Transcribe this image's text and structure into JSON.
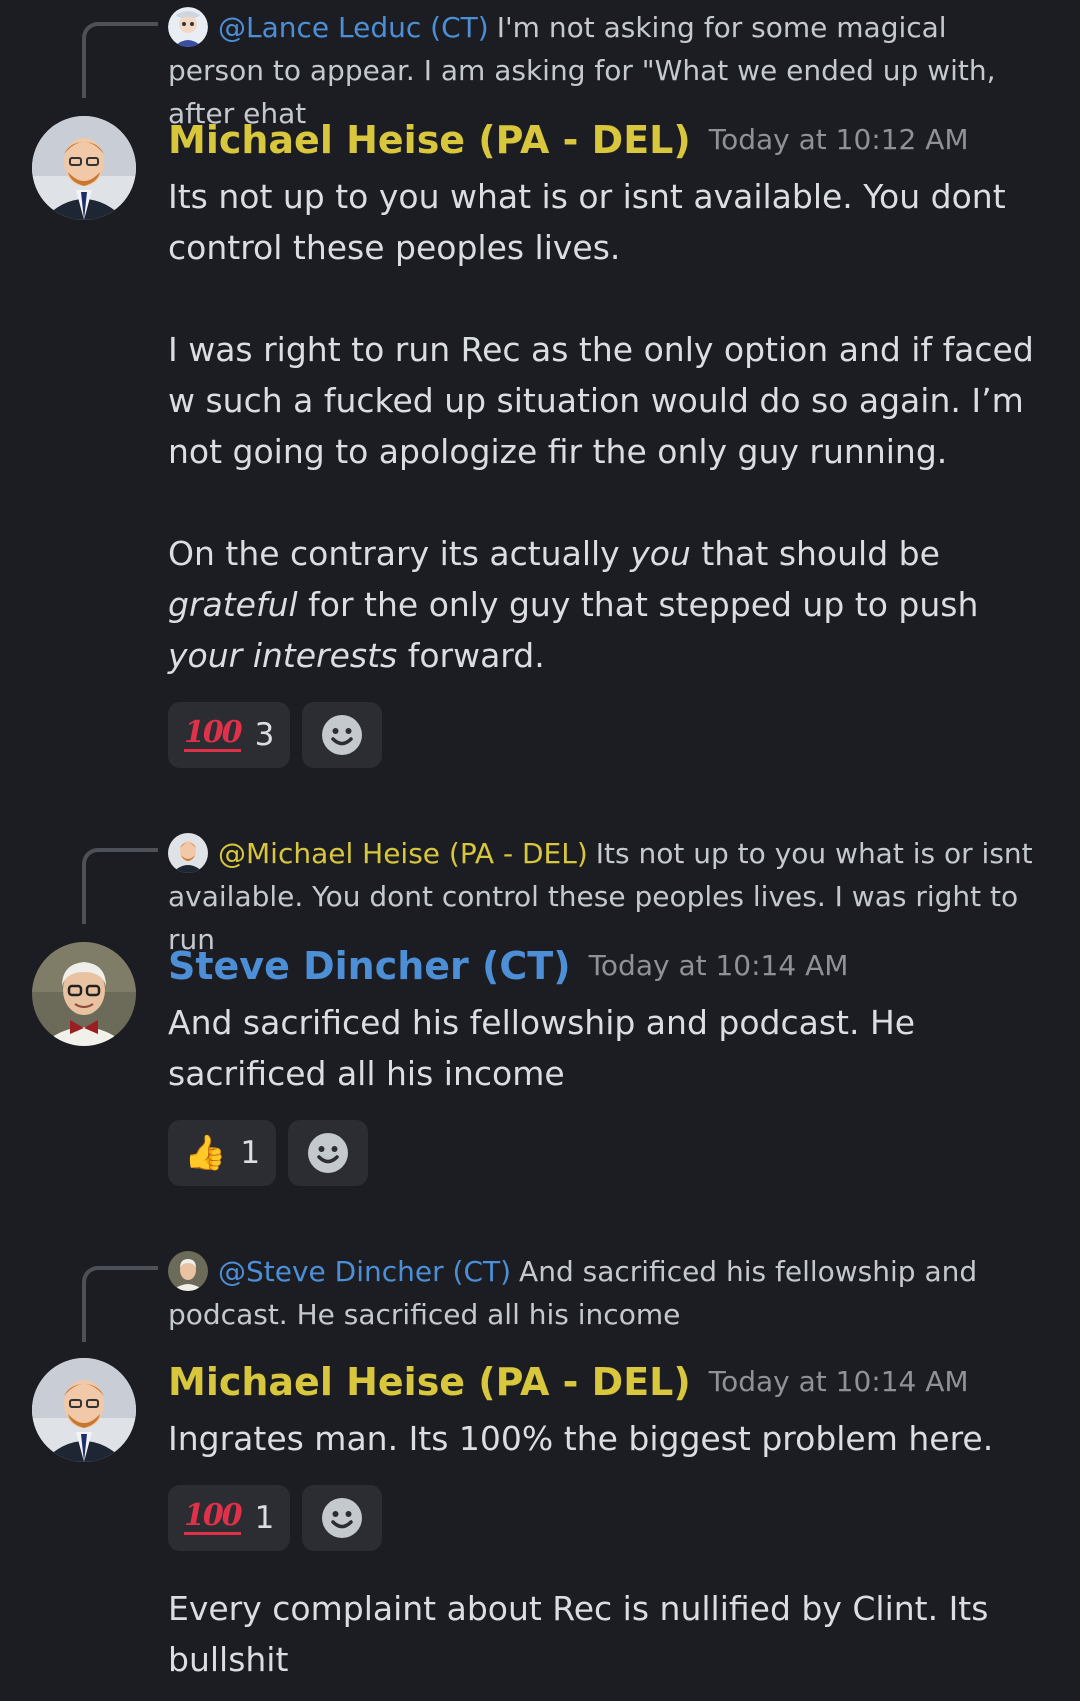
{
  "messages": [
    {
      "reply": {
        "mention": "@Lance Leduc (CT)",
        "text": "I'm not asking for some magical person to appear.  I am asking for  \"What we ended up with, after ehat"
      },
      "author": "Michael Heise (PA - DEL)",
      "timestamp": "Today at 10:12 AM",
      "paragraphs": {
        "p1": "Its not up to you what is or isnt available. You dont control these peoples lives.",
        "p2": "I was right to run Rec as the only option and if faced w such a fucked up situation would do so again. I’m not going to apologize fir the only guy running.",
        "p3": {
          "a": "On the contrary its actually ",
          "b": "you",
          "c": " that should be ",
          "d": "grateful",
          "e": " for the only guy that stepped up to push ",
          "f": "your interests",
          "g": " forward."
        }
      },
      "reaction": {
        "emoji": "100",
        "count": "3"
      }
    },
    {
      "reply": {
        "mention": "@Michael Heise (PA - DEL)",
        "text": "Its not up to you what is or isnt available. You dont control these peoples lives.  I was right to run"
      },
      "author": "Steve Dincher (CT)",
      "timestamp": "Today at 10:14 AM",
      "paragraphs": {
        "p1": "And sacrificed his fellowship and podcast. He sacrificed all his income"
      },
      "reaction": {
        "emoji": "👍",
        "count": "1"
      }
    },
    {
      "reply": {
        "mention": "@Steve Dincher (CT)",
        "text": "And sacrificed his fellowship and podcast. He sacrificed all his income"
      },
      "author": "Michael Heise (PA - DEL)",
      "timestamp": "Today at 10:14 AM",
      "paragraphs": {
        "p1": "Ingrates man. Its 100% the biggest problem here."
      },
      "reaction": {
        "emoji": "100",
        "count": "1"
      }
    },
    {
      "paragraphs": {
        "p1": "Every complaint about Rec is nullified by Clint. Its bullshit"
      }
    }
  ],
  "colors": {
    "background": "#1c1d22",
    "author_gold": "#d8c73c",
    "author_blue": "#4d8fd6",
    "reaction_bg": "#2b2d33"
  },
  "icons": {
    "reaction_100": "hundred-points-icon",
    "reaction_thumb": "thumbs-up-icon",
    "add_reaction": "smile-icon"
  }
}
